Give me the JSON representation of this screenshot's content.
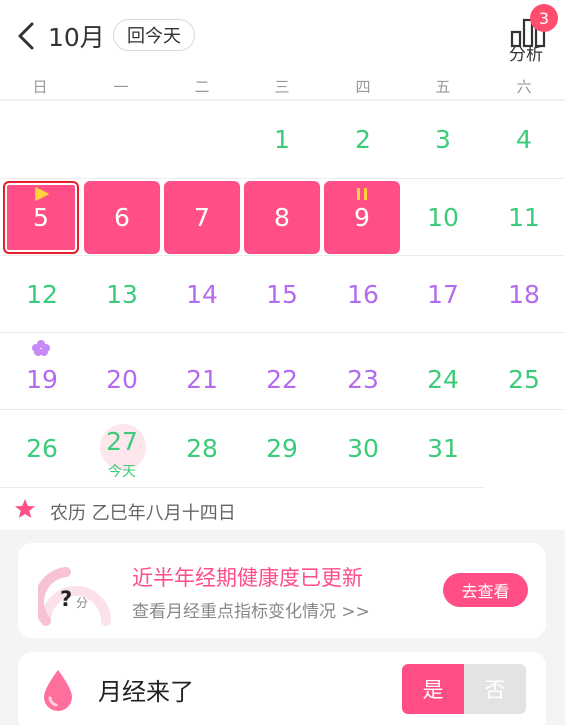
{
  "header": {
    "month_title": "10月",
    "today_button": "回今天",
    "analysis_label": "分析",
    "analysis_badge": "3"
  },
  "weekdays": [
    "日",
    "一",
    "二",
    "三",
    "四",
    "五",
    "六"
  ],
  "calendar": {
    "rows": [
      [
        "",
        "",
        "",
        "1",
        "2",
        "3",
        "4"
      ],
      [
        "5",
        "6",
        "7",
        "8",
        "9",
        "10",
        "11"
      ],
      [
        "12",
        "13",
        "14",
        "15",
        "16",
        "17",
        "18"
      ],
      [
        "19",
        "20",
        "21",
        "22",
        "23",
        "24",
        "25"
      ],
      [
        "26",
        "27",
        "28",
        "29",
        "30",
        "31",
        ""
      ]
    ],
    "today_label": "今天",
    "period_days": [
      "5",
      "6",
      "7",
      "8",
      "9"
    ],
    "selected_day": "5",
    "colors": {
      "green": "#3ccb7a",
      "purple": "#b36bf0",
      "period": "#ff4f86"
    }
  },
  "lunar": {
    "text": "农历 乙巳年八月十四日"
  },
  "health_card": {
    "title": "近半年经期健康度已更新",
    "subtitle": "查看月经重点指标变化情况 >>",
    "score": "?",
    "score_unit": "分",
    "button": "去查看"
  },
  "period_card": {
    "label": "月经来了",
    "yes": "是",
    "no": "否"
  }
}
